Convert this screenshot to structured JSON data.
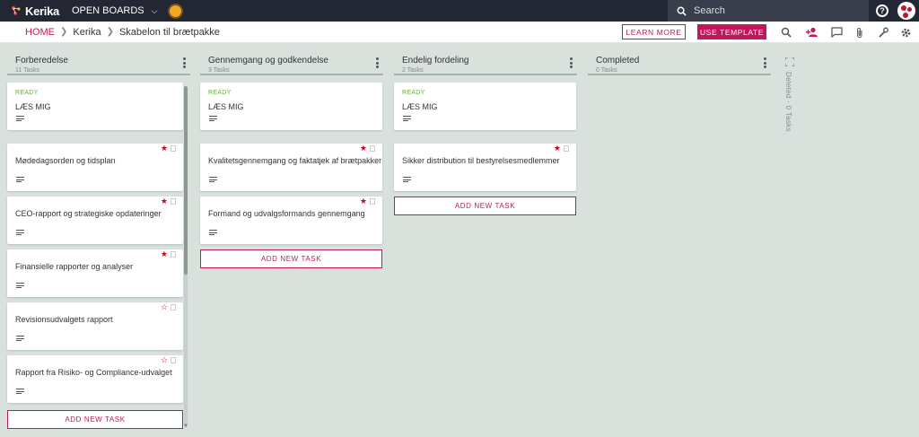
{
  "topbar": {
    "logo_text": "Kerika",
    "open_boards": "OPEN BOARDS",
    "search_placeholder": "Search",
    "help": "?"
  },
  "breadcrumb": {
    "home": "HOME",
    "items": [
      "Kerika",
      "Skabelon til brætpakke"
    ]
  },
  "actions": {
    "learn_more": "LEARN MORE",
    "use_template": "USE TEMPLATE"
  },
  "add_task_label": "ADD NEW TASK",
  "columns": [
    {
      "title": "Forberedelse",
      "count": "11 Tasks",
      "cards": [
        {
          "ready": "READY",
          "title": "LÆS MIG"
        },
        {
          "title": "Mødedagsorden og tidsplan",
          "star": "filled"
        },
        {
          "title": "CEO-rapport og strategiske opdateringer",
          "star": "filled"
        },
        {
          "title": "Finansielle rapporter og analyser",
          "star": "filled"
        },
        {
          "title": "Revisionsudvalgets rapport",
          "star": "outline"
        },
        {
          "title": "Rapport fra Risiko- og Compliance-udvalget",
          "star": "outline"
        }
      ]
    },
    {
      "title": "Gennemgang og godkendelse",
      "count": "3 Tasks",
      "cards": [
        {
          "ready": "READY",
          "title": "LÆS MIG"
        },
        {
          "title": "Kvalitetsgennemgang og faktatjek af brætpakker",
          "star": "filled"
        },
        {
          "title": "Formand og udvalgsformands gennemgang",
          "star": "filled"
        }
      ]
    },
    {
      "title": "Endelig fordeling",
      "count": "2 Tasks",
      "cards": [
        {
          "ready": "READY",
          "title": "LÆS MIG"
        },
        {
          "title": "Sikker distribution til bestyrelsesmedlemmer",
          "star": "filled"
        }
      ]
    },
    {
      "title": "Completed",
      "count": "0 Tasks",
      "cards": []
    }
  ],
  "deleted_label": "Deleted · 0 Tasks",
  "colors": {
    "accent": "#c2185b",
    "topbar": "#222733",
    "board_bg": "#d9e1dd",
    "ready": "#6aab45",
    "star": "#d0021b"
  }
}
